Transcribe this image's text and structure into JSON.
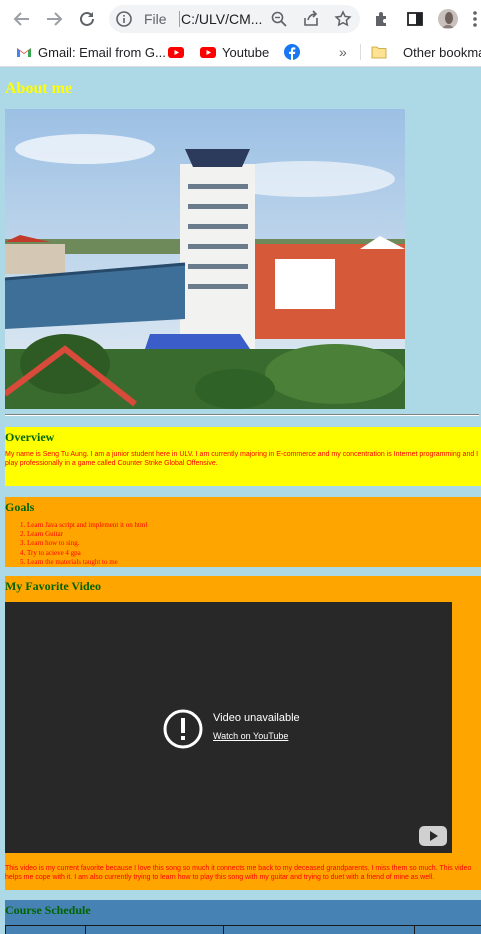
{
  "browser": {
    "url_scheme_label": "File",
    "url_text": "C:/ULV/CM...",
    "bookmarks": [
      {
        "label": "Gmail: Email from G..."
      },
      {
        "label": ""
      },
      {
        "label": "Youtube"
      },
      {
        "label": ""
      }
    ],
    "other_bookmarks": "Other bookmark",
    "overflow_chevron": "»"
  },
  "page": {
    "title": "About me",
    "overview": {
      "heading": "Overview",
      "text": "My name is Seng Tu Aung. I am a junior student here in ULV. I am currently majoring in E-commerce and my concentration is Internet programming and I play professionally in a game called Counter Strike Global Offensive."
    },
    "goals": {
      "heading": "Goals",
      "items": [
        "Learn Java script and implement it on html",
        "Learn Guitar",
        "Learn how to sing.",
        "Try to acieve 4 gpa",
        "Learn the materials taught to me"
      ]
    },
    "video": {
      "heading": "My Favorite Video",
      "unavailable": "Video unavailable",
      "watch_link": "Watch on YouTube",
      "caption": "This video is my current favorite because I love this song so much it connects me back to my deceased grandparents. I miss them so much. This video helps me cope with it. I am also currently trying to learn how to play this song with my guitar and trying to duet with a friend of mine as well."
    },
    "schedule": {
      "heading": "Course Schedule"
    }
  },
  "colors": {
    "page_bg": "#add8e6",
    "title": "#ffff00",
    "heading": "#006400",
    "body_text": "#ff0000",
    "overview_bg": "#ffff00",
    "goals_bg": "#ffa500",
    "schedule_bg": "#4682b4"
  }
}
